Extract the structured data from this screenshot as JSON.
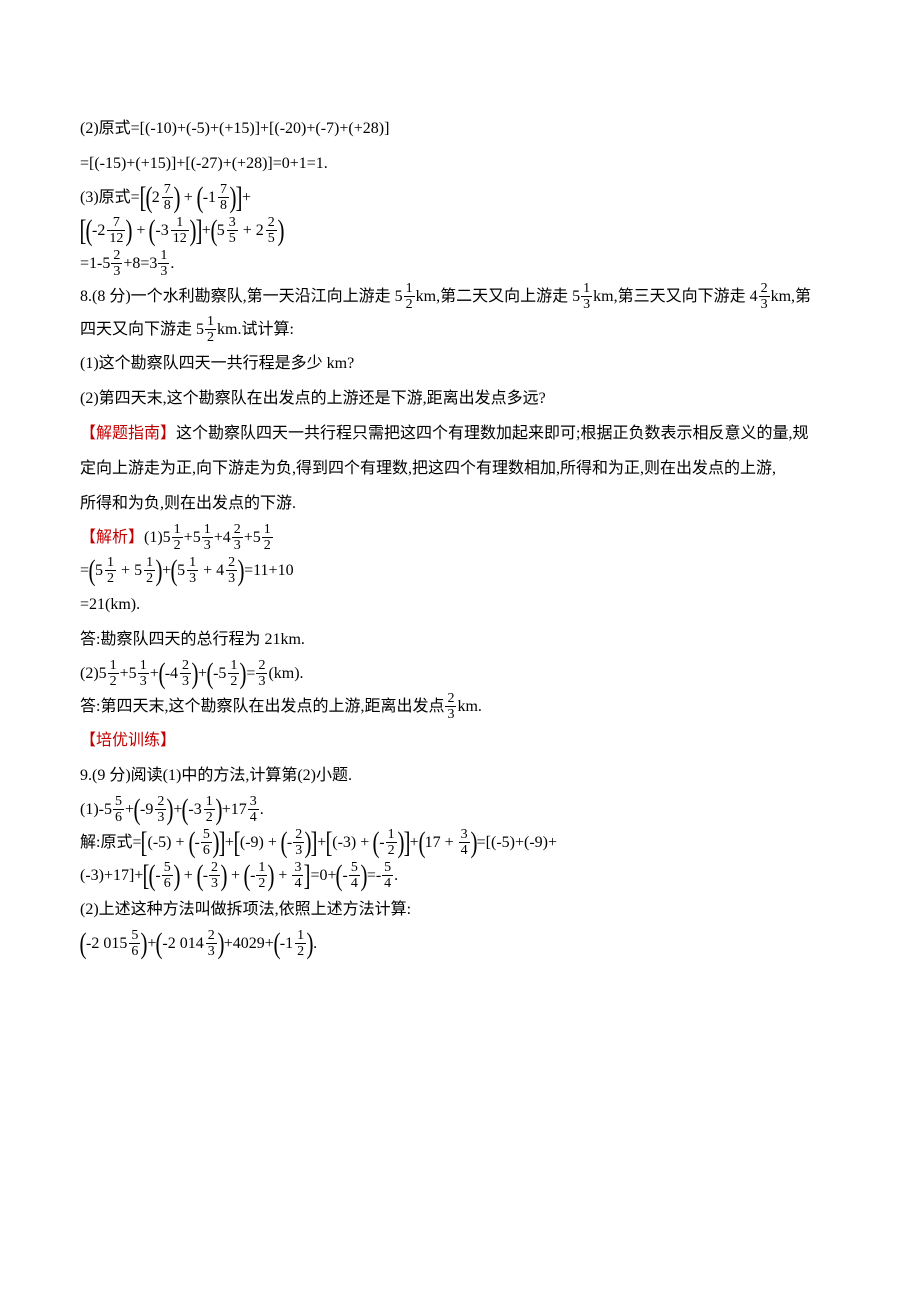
{
  "l1": "(2)原式=[(-10)+(-5)+(+15)]+[(-20)+(-7)+(+28)]",
  "l2": "=[(-15)+(+15)]+[(-27)+(+28)]=0+1=1.",
  "l3_pre": "(3)原式=",
  "l3_a_w": "2",
  "l3_a_n": "7",
  "l3_a_d": "8",
  "l3_b_w": "1",
  "l3_b_n": "7",
  "l3_b_d": "8",
  "l4_a_w": "2",
  "l4_a_n": "7",
  "l4_a_d": "12",
  "l4_b_w": "3",
  "l4_b_n": "1",
  "l4_b_d": "12",
  "l4_c_w": "5",
  "l4_c_n": "3",
  "l4_c_d": "5",
  "l4_d_w": "2",
  "l4_d_n": "2",
  "l4_d_d": "5",
  "l5_pre": "=1-5",
  "l5_a_n": "2",
  "l5_a_d": "3",
  "l5_mid": "+8=3",
  "l5_b_n": "1",
  "l5_b_d": "3",
  "l5_end": ".",
  "p8_pre": "8.(8 分)一个水利勘察队,第一天沿江向上游走 5",
  "p8_f1_n": "1",
  "p8_f1_d": "2",
  "p8_m1": "km,第二天又向上游走 5",
  "p8_f2_n": "1",
  "p8_f2_d": "3",
  "p8_m2": "km,第三天又向下游走 4",
  "p8_f3_n": "2",
  "p8_f3_d": "3",
  "p8_m3": "km,第",
  "p8b_pre": "四天又向下游走 5",
  "p8b_f_n": "1",
  "p8b_f_d": "2",
  "p8b_end": "km.试计算:",
  "q1": "(1)这个勘察队四天一共行程是多少 km?",
  "q2": "(2)第四天末,这个勘察队在出发点的上游还是下游,距离出发点多远?",
  "hint_label": "【解题指南】",
  "hint1": "这个勘察队四天一共行程只需把这四个有理数加起来即可;根据正负数表示相反意义的量,规",
  "hint2": "定向上游走为正,向下游走为负,得到四个有理数,把这四个有理数相加,所得和为正,则在出发点的上游,",
  "hint3": "所得和为负,则在出发点的下游.",
  "sol_label": "【解析】",
  "s1_pre": "(1)5",
  "s1_a_n": "1",
  "s1_a_d": "2",
  "s1_p1": "+5",
  "s1_b_n": "1",
  "s1_b_d": "3",
  "s1_p2": "+4",
  "s1_c_n": "2",
  "s1_c_d": "3",
  "s1_p3": "+5",
  "s1_d_n": "1",
  "s1_d_d": "2",
  "s2_a_w": "5",
  "s2_a_n": "1",
  "s2_a_d": "2",
  "s2_b_w": "5",
  "s2_b_n": "1",
  "s2_b_d": "2",
  "s2_c_w": "5",
  "s2_c_n": "1",
  "s2_c_d": "3",
  "s2_d_w": "4",
  "s2_d_n": "2",
  "s2_d_d": "3",
  "s2_end": "=11+10",
  "s3": "=21(km).",
  "ans1": "答:勘察队四天的总行程为 21km.",
  "s4_pre": "(2)5",
  "s4_a_n": "1",
  "s4_a_d": "2",
  "s4_p1": "+5",
  "s4_b_n": "1",
  "s4_b_d": "3",
  "s4_c_w": "4",
  "s4_c_n": "2",
  "s4_c_d": "3",
  "s4_d_w": "5",
  "s4_d_n": "1",
  "s4_d_d": "2",
  "s4_e_n": "2",
  "s4_e_d": "3",
  "s4_end": "(km).",
  "ans2_pre": "答:第四天末,这个勘察队在出发点的上游,距离出发点",
  "ans2_f_n": "2",
  "ans2_f_d": "3",
  "ans2_end": "km.",
  "adv_label": "【培优训练】",
  "p9_head": "9.(9 分)阅读(1)中的方法,计算第(2)小题.",
  "p9a_pre": "(1)-5",
  "p9a_a_n": "5",
  "p9a_a_d": "6",
  "p9a_b_w": "9",
  "p9a_b_n": "2",
  "p9a_b_d": "3",
  "p9a_c_w": "3",
  "p9a_c_n": "1",
  "p9a_c_d": "2",
  "p9a_mid": "+17",
  "p9a_d_n": "3",
  "p9a_d_d": "4",
  "p9a_end": ".",
  "p9b_pre": "解:原式=",
  "p9b_s1_a": "(-5)",
  "p9b_s1_b_n": "5",
  "p9b_s1_b_d": "6",
  "p9b_s2_a": "(-9)",
  "p9b_s2_b_n": "2",
  "p9b_s2_b_d": "3",
  "p9b_s3_a": "(-3)",
  "p9b_s3_b_n": "1",
  "p9b_s3_b_d": "2",
  "p9b_s4_a": "17",
  "p9b_s4_b_n": "3",
  "p9b_s4_b_d": "4",
  "p9b_tail": "=[(-5)+(-9)+",
  "p9c_pre": "(-3)+17]+",
  "p9c_a_n": "5",
  "p9c_a_d": "6",
  "p9c_b_n": "2",
  "p9c_b_d": "3",
  "p9c_c_n": "1",
  "p9c_c_d": "2",
  "p9c_d_n": "3",
  "p9c_d_d": "4",
  "p9c_mid": "=0+",
  "p9c_e_n": "5",
  "p9c_e_d": "4",
  "p9c_eq": "=-",
  "p9c_f_n": "5",
  "p9c_f_d": "4",
  "p9c_end": ".",
  "p9d": "(2)上述这种方法叫做拆项法,依照上述方法计算:",
  "p9e_a_w": "2 015",
  "p9e_a_n": "5",
  "p9e_a_d": "6",
  "p9e_b_w": "2 014",
  "p9e_b_n": "2",
  "p9e_b_d": "3",
  "p9e_mid": "+4029+",
  "p9e_c_w": "1",
  "p9e_c_n": "1",
  "p9e_c_d": "2",
  "p9e_end": "."
}
